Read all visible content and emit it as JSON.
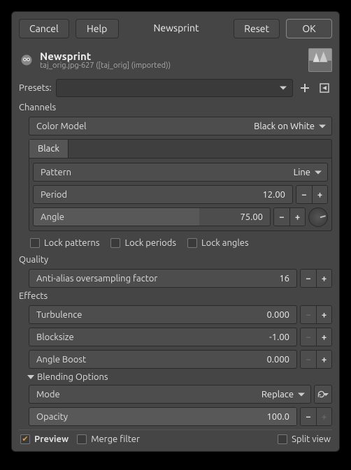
{
  "buttons": {
    "cancel": "Cancel",
    "help": "Help",
    "title": "Newsprint",
    "reset": "Reset",
    "ok": "OK"
  },
  "header": {
    "title": "Newsprint",
    "subtitle": "taj_orig.jpg-627 ([taj_orig] (imported))"
  },
  "presets": {
    "label": "Presets:",
    "value": "",
    "add_icon": "+",
    "menu_icon": "◁"
  },
  "channels": {
    "title": "Channels",
    "colormodel": {
      "label": "Color Model",
      "value": "Black on White"
    },
    "tab": "Black",
    "pattern": {
      "label": "Pattern",
      "value": "Line"
    },
    "period": {
      "label": "Period",
      "value": "12.00"
    },
    "angle": {
      "label": "Angle",
      "value": "75.00"
    },
    "lock_patterns": "Lock patterns",
    "lock_periods": "Lock periods",
    "lock_angles": "Lock angles"
  },
  "quality": {
    "title": "Quality",
    "aa": {
      "label": "Anti-alias oversampling factor",
      "value": "16"
    }
  },
  "effects": {
    "title": "Effects",
    "turbulence": {
      "label": "Turbulence",
      "value": "0.000"
    },
    "blocksize": {
      "label": "Blocksize",
      "value": "-1.00"
    },
    "angleboost": {
      "label": "Angle Boost",
      "value": "0.000"
    }
  },
  "blending": {
    "title": "Blending Options",
    "mode": {
      "label": "Mode",
      "value": "Replace"
    },
    "opacity": {
      "label": "Opacity",
      "value": "100.0"
    }
  },
  "footer": {
    "preview": "Preview",
    "merge": "Merge filter",
    "split": "Split view"
  }
}
